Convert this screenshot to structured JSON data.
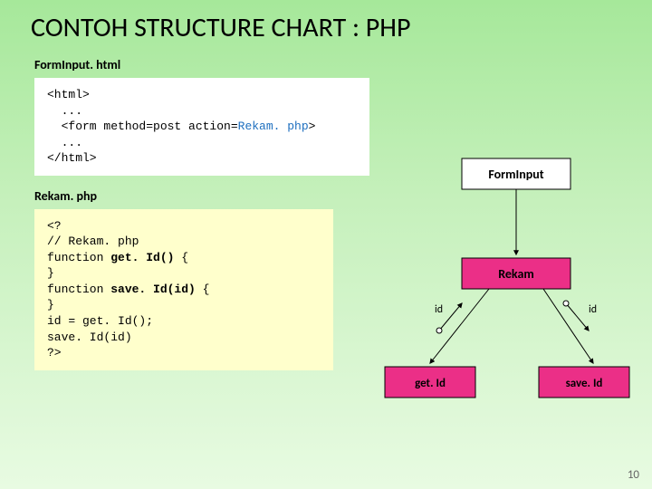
{
  "title": "CONTOH STRUCTURE CHART : PHP",
  "sections": {
    "html_file": "FormInput. html",
    "php_file": "Rekam. php"
  },
  "code_html": {
    "l1": "<html>",
    "l2": "  ...",
    "l3a": "  <form method=post action=",
    "l3b": "Rekam. php",
    "l3c": ">",
    "l4": "  ...",
    "l5": "</html>"
  },
  "code_php": {
    "l1": "<?",
    "l2": "// Rekam. php",
    "l3a": "function ",
    "l3b": "get. Id()",
    "l3c": " {",
    "l4": "}",
    "l5a": "function ",
    "l5b": "save. Id(id)",
    "l5c": " {",
    "l6": "}",
    "l7": "id = get. Id();",
    "l8": "save. Id(id)",
    "l9": "?>"
  },
  "diagram": {
    "n1": "FormInput",
    "n2": "Rekam",
    "n3": "get. Id",
    "n4": "save. Id",
    "e_left": "id",
    "e_right": "id"
  },
  "page_number": "10",
  "chart_data": {
    "type": "structure-chart",
    "nodes": [
      {
        "id": "FormInput",
        "label": "FormInput",
        "level": 0
      },
      {
        "id": "Rekam",
        "label": "Rekam",
        "level": 1
      },
      {
        "id": "getId",
        "label": "get. Id",
        "level": 2
      },
      {
        "id": "saveId",
        "label": "save. Id",
        "level": 2
      }
    ],
    "edges": [
      {
        "from": "FormInput",
        "to": "Rekam"
      },
      {
        "from": "Rekam",
        "to": "getId",
        "return_label": "id",
        "direction": "return"
      },
      {
        "from": "Rekam",
        "to": "saveId",
        "param_label": "id",
        "direction": "call"
      }
    ]
  }
}
